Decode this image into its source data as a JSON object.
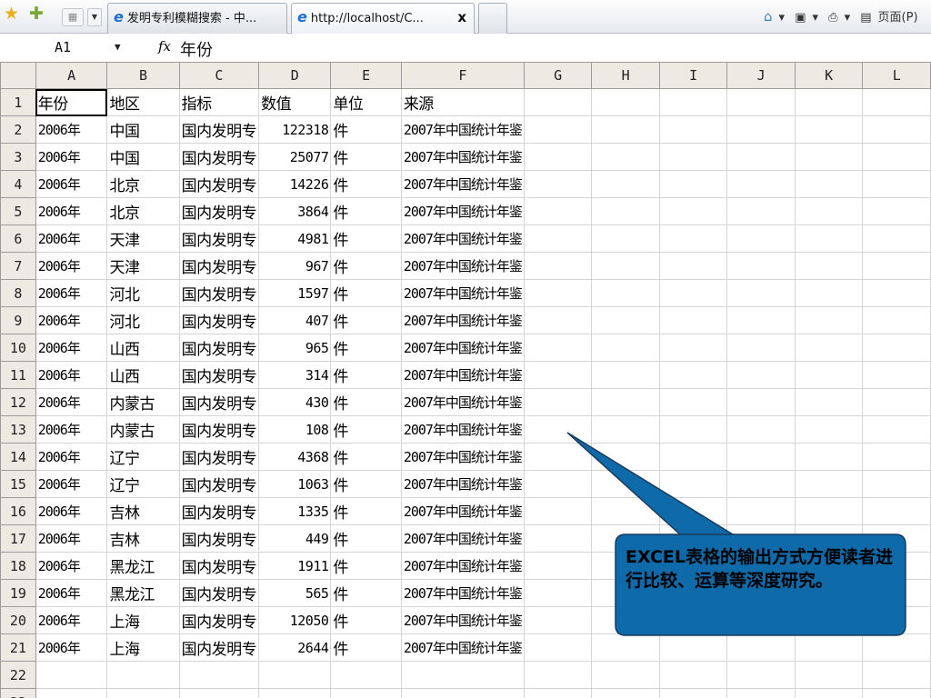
{
  "browser": {
    "tabs": [
      {
        "title": "发明专利模糊搜索 - 中...",
        "active": false
      },
      {
        "title": "http://localhost/C...",
        "active": true,
        "close_label": "x"
      },
      {
        "title": "",
        "active": false
      }
    ],
    "command_bar": {
      "page_label": "页面(P)"
    }
  },
  "formula_bar": {
    "name_box": "A1",
    "fx_label": "fx",
    "formula": "年份"
  },
  "sheet": {
    "columns": [
      "A",
      "B",
      "C",
      "D",
      "E",
      "F",
      "G",
      "H",
      "I",
      "J",
      "K",
      "L"
    ],
    "header_row": [
      "年份",
      "地区",
      "指标",
      "数值",
      "单位",
      "来源"
    ],
    "rows": [
      [
        "2006年",
        "中国",
        "国内发明专",
        "122318",
        "件",
        "2007年中国统计年鉴"
      ],
      [
        "2006年",
        "中国",
        "国内发明专",
        "25077",
        "件",
        "2007年中国统计年鉴"
      ],
      [
        "2006年",
        "北京",
        "国内发明专",
        "14226",
        "件",
        "2007年中国统计年鉴"
      ],
      [
        "2006年",
        "北京",
        "国内发明专",
        "3864",
        "件",
        "2007年中国统计年鉴"
      ],
      [
        "2006年",
        "天津",
        "国内发明专",
        "4981",
        "件",
        "2007年中国统计年鉴"
      ],
      [
        "2006年",
        "天津",
        "国内发明专",
        "967",
        "件",
        "2007年中国统计年鉴"
      ],
      [
        "2006年",
        "河北",
        "国内发明专",
        "1597",
        "件",
        "2007年中国统计年鉴"
      ],
      [
        "2006年",
        "河北",
        "国内发明专",
        "407",
        "件",
        "2007年中国统计年鉴"
      ],
      [
        "2006年",
        "山西",
        "国内发明专",
        "965",
        "件",
        "2007年中国统计年鉴"
      ],
      [
        "2006年",
        "山西",
        "国内发明专",
        "314",
        "件",
        "2007年中国统计年鉴"
      ],
      [
        "2006年",
        "内蒙古",
        "国内发明专",
        "430",
        "件",
        "2007年中国统计年鉴"
      ],
      [
        "2006年",
        "内蒙古",
        "国内发明专",
        "108",
        "件",
        "2007年中国统计年鉴"
      ],
      [
        "2006年",
        "辽宁",
        "国内发明专",
        "4368",
        "件",
        "2007年中国统计年鉴"
      ],
      [
        "2006年",
        "辽宁",
        "国内发明专",
        "1063",
        "件",
        "2007年中国统计年鉴"
      ],
      [
        "2006年",
        "吉林",
        "国内发明专",
        "1335",
        "件",
        "2007年中国统计年鉴"
      ],
      [
        "2006年",
        "吉林",
        "国内发明专",
        "449",
        "件",
        "2007年中国统计年鉴"
      ],
      [
        "2006年",
        "黑龙江",
        "国内发明专",
        "1911",
        "件",
        "2007年中国统计年鉴"
      ],
      [
        "2006年",
        "黑龙江",
        "国内发明专",
        "565",
        "件",
        "2007年中国统计年鉴"
      ],
      [
        "2006年",
        "上海",
        "国内发明专",
        "12050",
        "件",
        "2007年中国统计年鉴"
      ],
      [
        "2006年",
        "上海",
        "国内发明专",
        "2644",
        "件",
        "2007年中国统计年鉴"
      ]
    ],
    "active_cell": "A1"
  },
  "callout": {
    "text": "EXCEL表格的输出方式方便读者进行比较、运算等深度研究。",
    "fill_color": "#0e6aa8",
    "border_color": "#1a3a5c"
  }
}
